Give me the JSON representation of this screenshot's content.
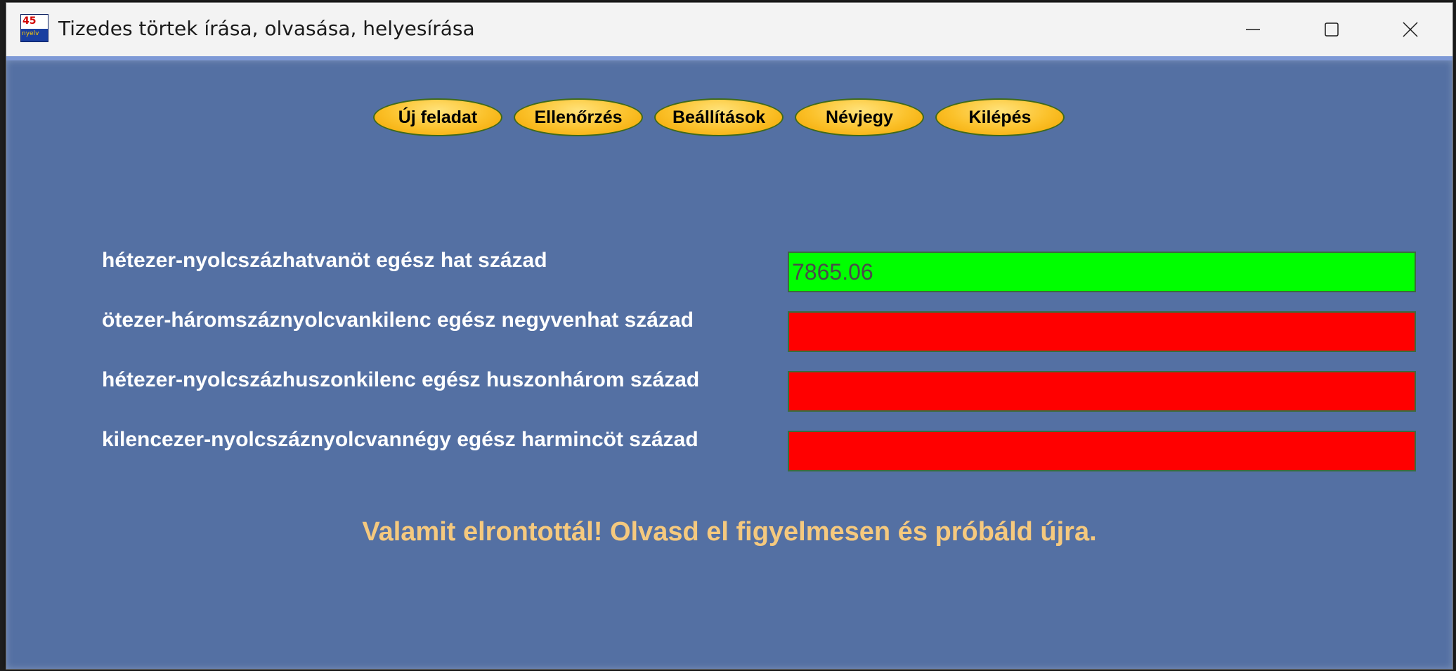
{
  "window": {
    "title": "Tizedes törtek írása, olvasása, helyesírása",
    "icon_digits": "45",
    "icon_word": "nyelv"
  },
  "toolbar": {
    "buttons": [
      {
        "label": "Új feladat"
      },
      {
        "label": "Ellenőrzés"
      },
      {
        "label": "Beállítások"
      },
      {
        "label": "Névjegy"
      },
      {
        "label": "Kilépés"
      }
    ]
  },
  "rows": [
    {
      "label": "hétezer-nyolcszázhatvanöt egész hat század",
      "value": "7865.06",
      "status_color": "#00ff00"
    },
    {
      "label": "ötezer-háromszáznyolcvankilenc egész negyvenhat század",
      "value": "",
      "status_color": "#ff0000"
    },
    {
      "label": "hétezer-nyolcszázhuszonkilenc egész huszonhárom század",
      "value": "",
      "status_color": "#ff0000"
    },
    {
      "label": "kilencezer-nyolcszáznyolcvannégy egész harmincöt század",
      "value": "",
      "status_color": "#ff0000"
    }
  ],
  "feedback": "Valamit elrontottál! Olvasd el figyelmesen és próbáld újra.",
  "colors": {
    "background": "#5470a3",
    "button": "#fbc12a",
    "feedback_text": "#f5c97e",
    "correct": "#00ff00",
    "wrong": "#ff0000"
  }
}
